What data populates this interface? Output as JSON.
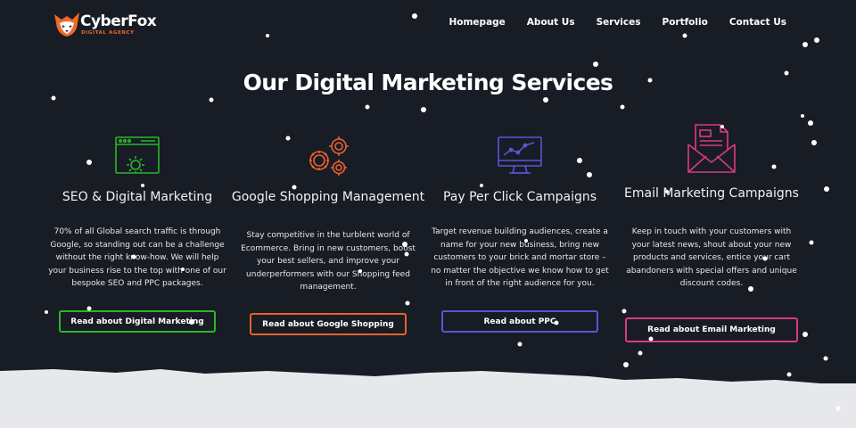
{
  "brand": {
    "name": "CyberFox",
    "tagline": "DIGITAL AGENCY"
  },
  "nav": {
    "items": [
      "Homepage",
      "About Us",
      "Services",
      "Portfolio",
      "Contact Us"
    ]
  },
  "page_title": "Our Digital Marketing Services",
  "services": [
    {
      "title": "SEO & Digital Marketing",
      "text": "70% of all Global search traffic is through Google, so standing out can be a challenge without the right know-how. We will help your business rise to the top with one of our bespoke SEO and PPC packages.",
      "button": "Read about Digital Marketing",
      "color": "#2bb52b",
      "icon": "browser-gear-icon"
    },
    {
      "title": "Google Shopping Management",
      "text": "Stay competitive in the turblent world of Ecommerce. Bring in new customers, boost your best sellers, and improve your underperformers with our Shopping feed management.",
      "button": "Read about Google Shopping",
      "color": "#e8622c",
      "icon": "gears-icon"
    },
    {
      "title": "Pay Per Click Campaigns",
      "text": "Target revenue building audiences, create a name for your new business, bring new customers to your brick and mortar store – no matter the objective we know how to get in front of the right audience for you.",
      "button": "Read about PPC",
      "color": "#5a55d6",
      "icon": "monitor-chart-icon"
    },
    {
      "title": "Email Marketing Campaigns",
      "text": "Keep in touch with your customers with your latest news, shout about your new products and services, entice your cart abandoners with special offers and unique discount codes.",
      "button": "Read about Email Marketing",
      "color": "#d93a82",
      "icon": "envelope-icon"
    }
  ],
  "colors": {
    "background": "#181c24",
    "snow": "#e6e8ec",
    "brand_orange": "#f0692c"
  }
}
